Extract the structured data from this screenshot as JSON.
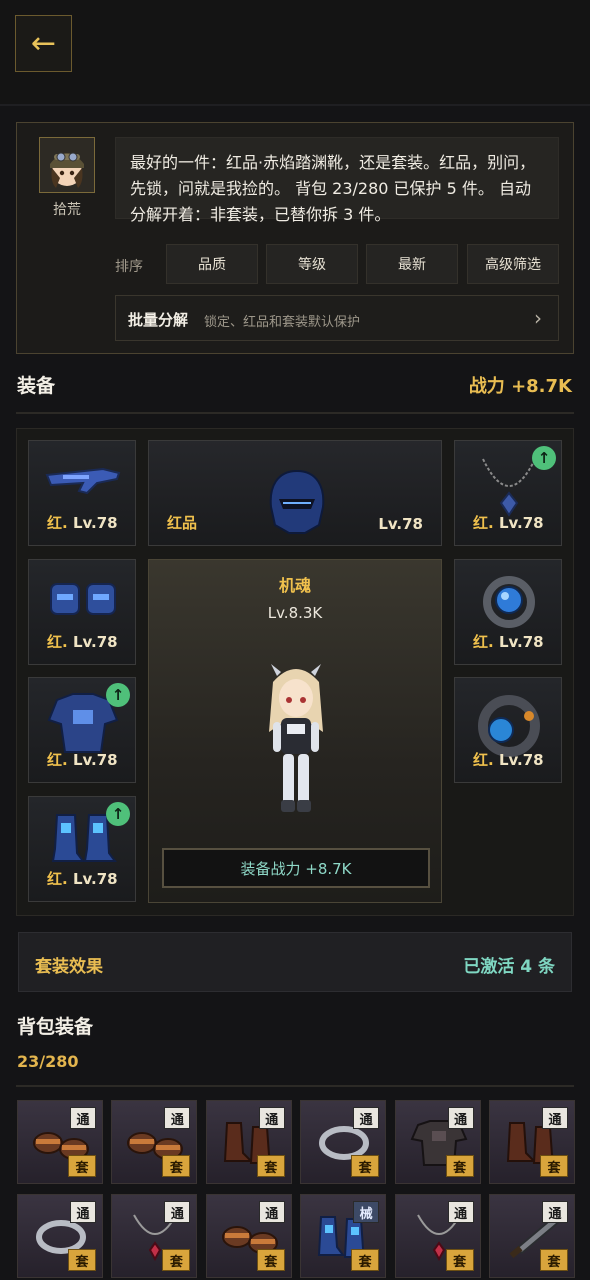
{
  "header": {
    "back_icon": "back-arrow-icon"
  },
  "advisor": {
    "name": "拾荒",
    "message": "最好的一件：红品·赤焰踏渊靴，还是套装。红品，别问，先锁，问就是我捡的。 背包 23/280 已保护 5 件。 自动分解开着：非套装，已替你拆 3 件。",
    "sort_label": "排序",
    "sort_buttons": [
      "品质",
      "等级",
      "最新",
      "高级筛选"
    ],
    "batch_title": "批量分解",
    "batch_desc": "锁定、红品和套装默认保护"
  },
  "equipment": {
    "title": "装备",
    "power": "战力 +8.7K",
    "slots": {
      "weapon": {
        "rarity": "红.",
        "level": "Lv.78"
      },
      "helmet": {
        "rarity": "红品",
        "level": "Lv.78"
      },
      "necklace": {
        "rarity": "红.",
        "level": "Lv.78"
      },
      "legs": {
        "rarity": "红.",
        "level": "Lv.78"
      },
      "ring": {
        "rarity": "红.",
        "level": "Lv.78"
      },
      "armor": {
        "rarity": "红.",
        "level": "Lv.78"
      },
      "bracer": {
        "rarity": "红.",
        "level": "Lv.78"
      },
      "boots": {
        "rarity": "红.",
        "level": "Lv.78"
      }
    },
    "mech": {
      "name": "机魂",
      "level": "Lv.8.3K",
      "power": "装备战力 +8.7K"
    }
  },
  "set_effect": {
    "title": "套装效果",
    "status": "已激活 4 条"
  },
  "bag": {
    "title": "背包装备",
    "count": "23/280",
    "items": [
      {
        "type": "通",
        "set": "套",
        "icon": "bracers-icon"
      },
      {
        "type": "通",
        "set": "套",
        "icon": "bracers-icon"
      },
      {
        "type": "通",
        "set": "套",
        "icon": "boots-icon"
      },
      {
        "type": "通",
        "set": "套",
        "icon": "ring-icon"
      },
      {
        "type": "通",
        "set": "套",
        "icon": "armor-icon"
      },
      {
        "type": "通",
        "set": "套",
        "icon": "boots-icon"
      },
      {
        "type": "通",
        "set": "套",
        "icon": "ring-icon"
      },
      {
        "type": "通",
        "set": "套",
        "icon": "necklace-icon"
      },
      {
        "type": "通",
        "set": "套",
        "icon": "bracers-icon"
      },
      {
        "type": "械",
        "set": "套",
        "icon": "mech-boots-icon"
      },
      {
        "type": "通",
        "set": "套",
        "icon": "necklace-icon"
      },
      {
        "type": "通",
        "set": "套",
        "icon": "sword-icon"
      }
    ]
  }
}
